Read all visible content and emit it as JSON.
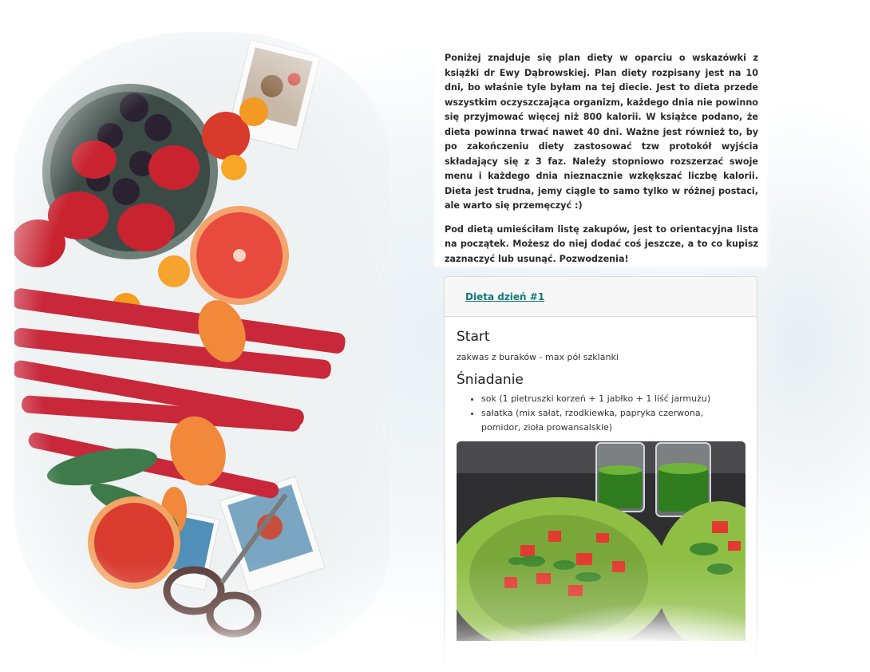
{
  "intro": {
    "paragraph1": "Poniżej znajduje się plan diety w oparciu o wskazówki z książki dr Ewy Dąbrowskiej. Plan diety rozpisany jest na 10 dni, bo właśnie tyle byłam na tej diecie. Jest to dieta przede wszystkim oczyszczająca organizm, każdego dnia nie powinno się przyjmować więcej niż 800 kalorii. W książce podano, że dieta powinna trwać nawet 40 dni. Ważne jest również to, by po zakończeniu diety zastosować tzw protokół wyjścia składający się z 3 faz. Należy stopniowo rozszerzać swoje menu i każdego dnia nieznacznie wzkększać liczbę kalorii. Dieta jest trudna, jemy ciągle to samo tylko w różnej postaci, ale warto się przemęczyć :)",
    "paragraph2": "Pod dietą umieściłam listę zakupów, jest to orientacyjna lista na początek. Możesz do niej dodać coś jeszcze, a to co kupisz zaznaczyć lub usunąć. Pozwodzenia!"
  },
  "day_card": {
    "link_label": "Dieta dzień #1",
    "meals": [
      {
        "title": "Start",
        "text": "zakwas z buraków - max pół szklanki"
      },
      {
        "title": "Śniadanie",
        "items": [
          "sok (1 pietruszki korzeń + 1 jabłko + 1 liść jarmużu)",
          "sałatka (mix sałat, rzodkiewka, papryka czerwona, pomidor, zioła prowansalskie)"
        ]
      }
    ]
  },
  "colors": {
    "link": "#157a7d",
    "card_header_bg": "#f7f7f7",
    "text": "#2a2a2a"
  }
}
